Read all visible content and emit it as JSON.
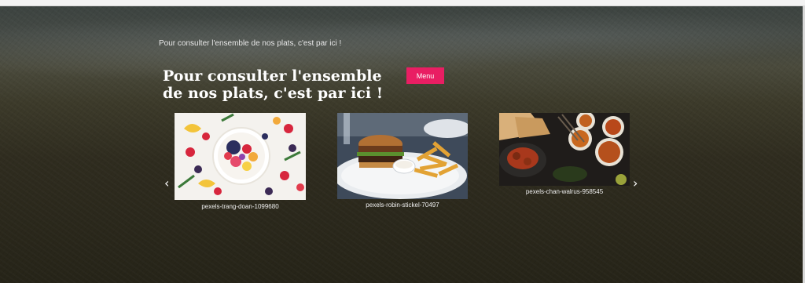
{
  "page": {
    "intro_text": "Pour consulter l'ensemble de nos plats, c'est par ici !",
    "heading": "Pour consulter l'ensemble de nos plats, c'est par ici !",
    "menu_button": "Menu"
  },
  "carousel": {
    "prev_icon": "chevron-left-icon",
    "next_icon": "chevron-right-icon",
    "slides": [
      {
        "caption": "pexels-trang-doan-1099680"
      },
      {
        "caption": "pexels-robin-stickel-70497"
      },
      {
        "caption": "pexels-chan-walrus-958545"
      }
    ]
  },
  "colors": {
    "accent": "#e91e63"
  }
}
